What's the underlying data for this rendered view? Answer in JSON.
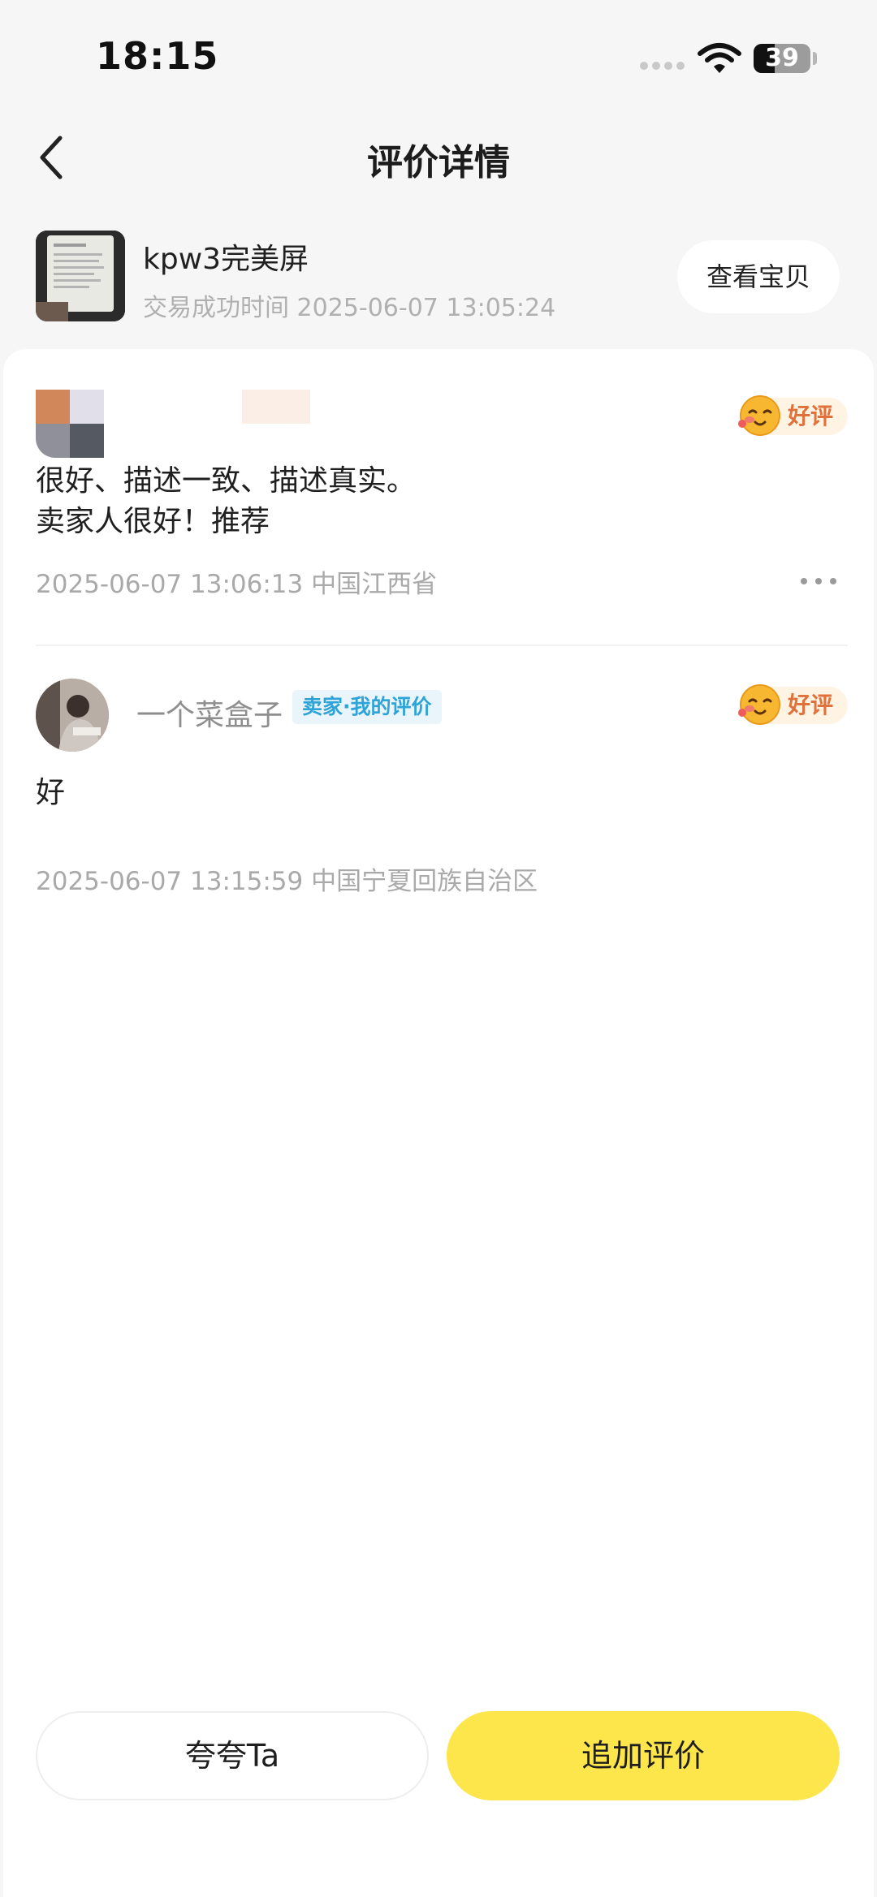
{
  "status_bar": {
    "time": "18:15",
    "battery_level": "39"
  },
  "header": {
    "title": "评价详情"
  },
  "product": {
    "title": "kpw3完美屏",
    "meta": "交易成功时间 2025-06-07 13:05:24",
    "view_button": "查看宝贝"
  },
  "reviews": [
    {
      "reviewer_name": "",
      "rating_label": "好评",
      "text": "很好、描述一致、描述真实。\n卖家人很好！推荐",
      "time_location": "2025-06-07 13:06:13  中国江西省"
    },
    {
      "reviewer_name": "一个菜盒子",
      "tag": "卖家·我的评价",
      "rating_label": "好评",
      "text": "好",
      "time_location": "2025-06-07 13:15:59  中国宁夏回族自治区"
    }
  ],
  "bottom_bar": {
    "praise_button": "夸夸Ta",
    "add_review_button": "追加评价"
  },
  "colors": {
    "accent_yellow": "#fde64b",
    "rating_orange": "#e0713a",
    "tag_blue": "#2ea3d8"
  },
  "icons": {
    "back": "chevron-left-icon",
    "rating": "smiling-face-icon",
    "more": "ellipsis-icon"
  }
}
